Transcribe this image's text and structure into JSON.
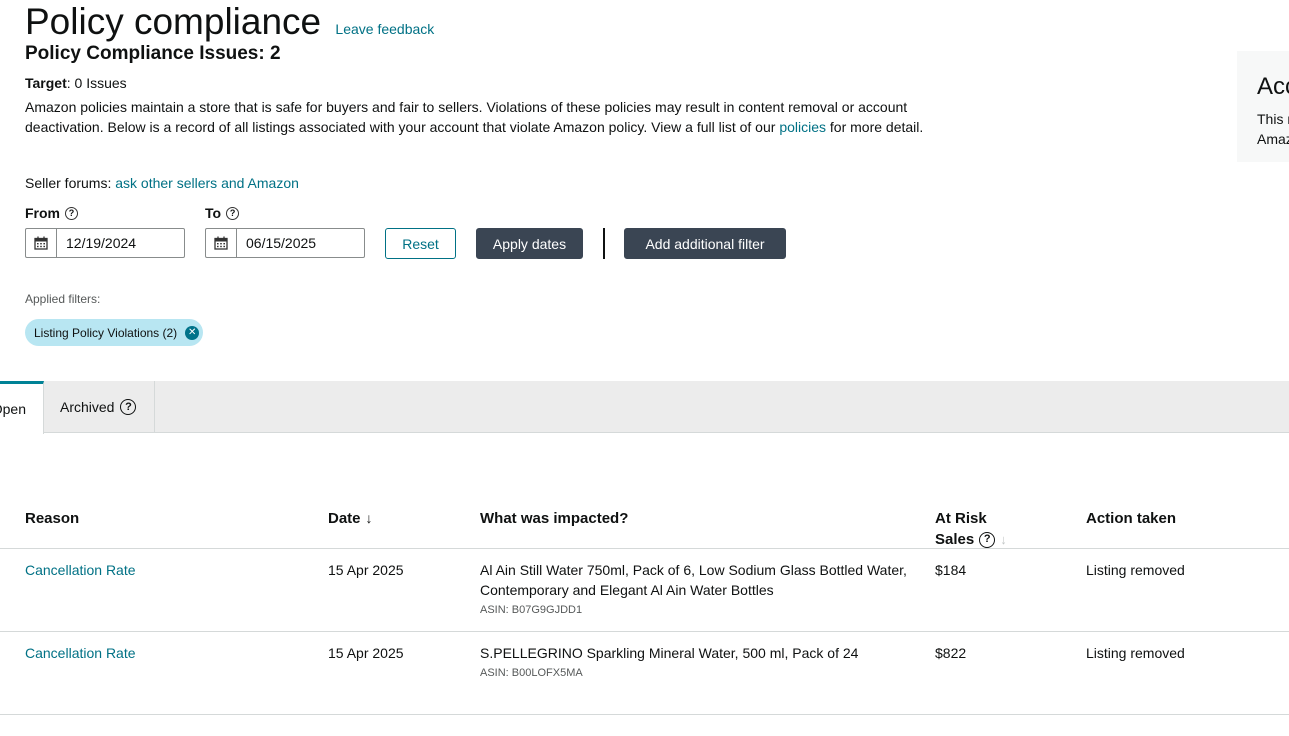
{
  "header": {
    "title": "Policy compliance",
    "feedback_link": "Leave feedback",
    "issues_heading": "Policy Compliance Issues: 2",
    "target_label": "Target",
    "target_value": ": 0 Issues",
    "description_part1": "Amazon policies maintain a store that is safe for buyers and fair to sellers. Violations of these policies may result in content removal or account deactivation. Below is a record of all listings associated with your account that violate Amazon policy. View a full list of our ",
    "description_link": "policies",
    "description_part2": " for more detail.",
    "forums_label": "Seller forums: ",
    "forums_link": "ask other sellers and Amazon"
  },
  "filters": {
    "from_label": "From",
    "to_label": "To",
    "from_date": "12/19/2024",
    "to_date": "06/15/2025",
    "reset_label": "Reset",
    "apply_label": "Apply dates",
    "add_filter_label": "Add additional filter",
    "applied_label": "Applied filters:",
    "chip_label": "Listing Policy Violations (2)"
  },
  "tabs": [
    {
      "label": "Open",
      "active": true
    },
    {
      "label": "Archived",
      "active": false
    }
  ],
  "table": {
    "headers": {
      "reason": "Reason",
      "date": "Date",
      "impacted": "What was impacted?",
      "risk_line1": "At Risk",
      "risk_line2": "Sales",
      "action": "Action taken"
    },
    "rows": [
      {
        "reason": "Cancellation Rate",
        "date": "15 Apr 2025",
        "product": "Al Ain Still Water 750ml, Pack of 6, Low Sodium Glass Bottled Water, Contemporary and Elegant Al Ain Water Bottles",
        "asin": "ASIN: B07G9GJDD1",
        "risk": "$184",
        "action": "Listing removed"
      },
      {
        "reason": "Cancellation Rate",
        "date": "15 Apr 2025",
        "product": "S.PELLEGRINO Sparkling Mineral Water, 500 ml, Pack of 24",
        "asin": "ASIN: B00LOFX5MA",
        "risk": "$822",
        "action": "Listing removed"
      }
    ]
  },
  "side_card": {
    "heading": "Acc",
    "line1": "This r",
    "line2": "Amaz"
  },
  "colors": {
    "link": "#007185",
    "dark_button": "#3a4553",
    "chip_bg": "#b8e6f2",
    "tab_accent": "#008296"
  }
}
